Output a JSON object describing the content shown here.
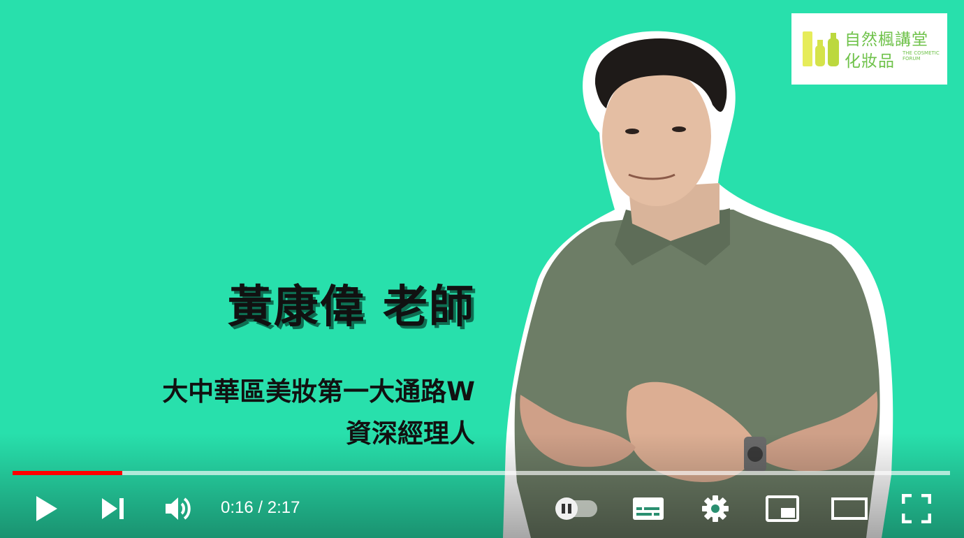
{
  "logo": {
    "line1": "自然楓講堂",
    "line2": "化妝品",
    "english": "THE COSMETIC FORUM"
  },
  "caption": {
    "name": "黃康偉 老師",
    "role_line1": "大中華區美妝第一大通路W",
    "role_line2": "資深經理人"
  },
  "player": {
    "current_time": "0:16",
    "duration": "2:17",
    "time_display": "0:16 / 2:17",
    "progress_fraction": 0.117,
    "buffered_fraction": 1.0,
    "autoplay_on": true,
    "accent_color": "#ff0000",
    "background_color": "#28e0ac",
    "icons": [
      "play-icon",
      "next-icon",
      "volume-icon",
      "autoplay-toggle",
      "subtitles-icon",
      "settings-icon",
      "miniplayer-icon",
      "theater-icon",
      "fullscreen-icon"
    ]
  }
}
